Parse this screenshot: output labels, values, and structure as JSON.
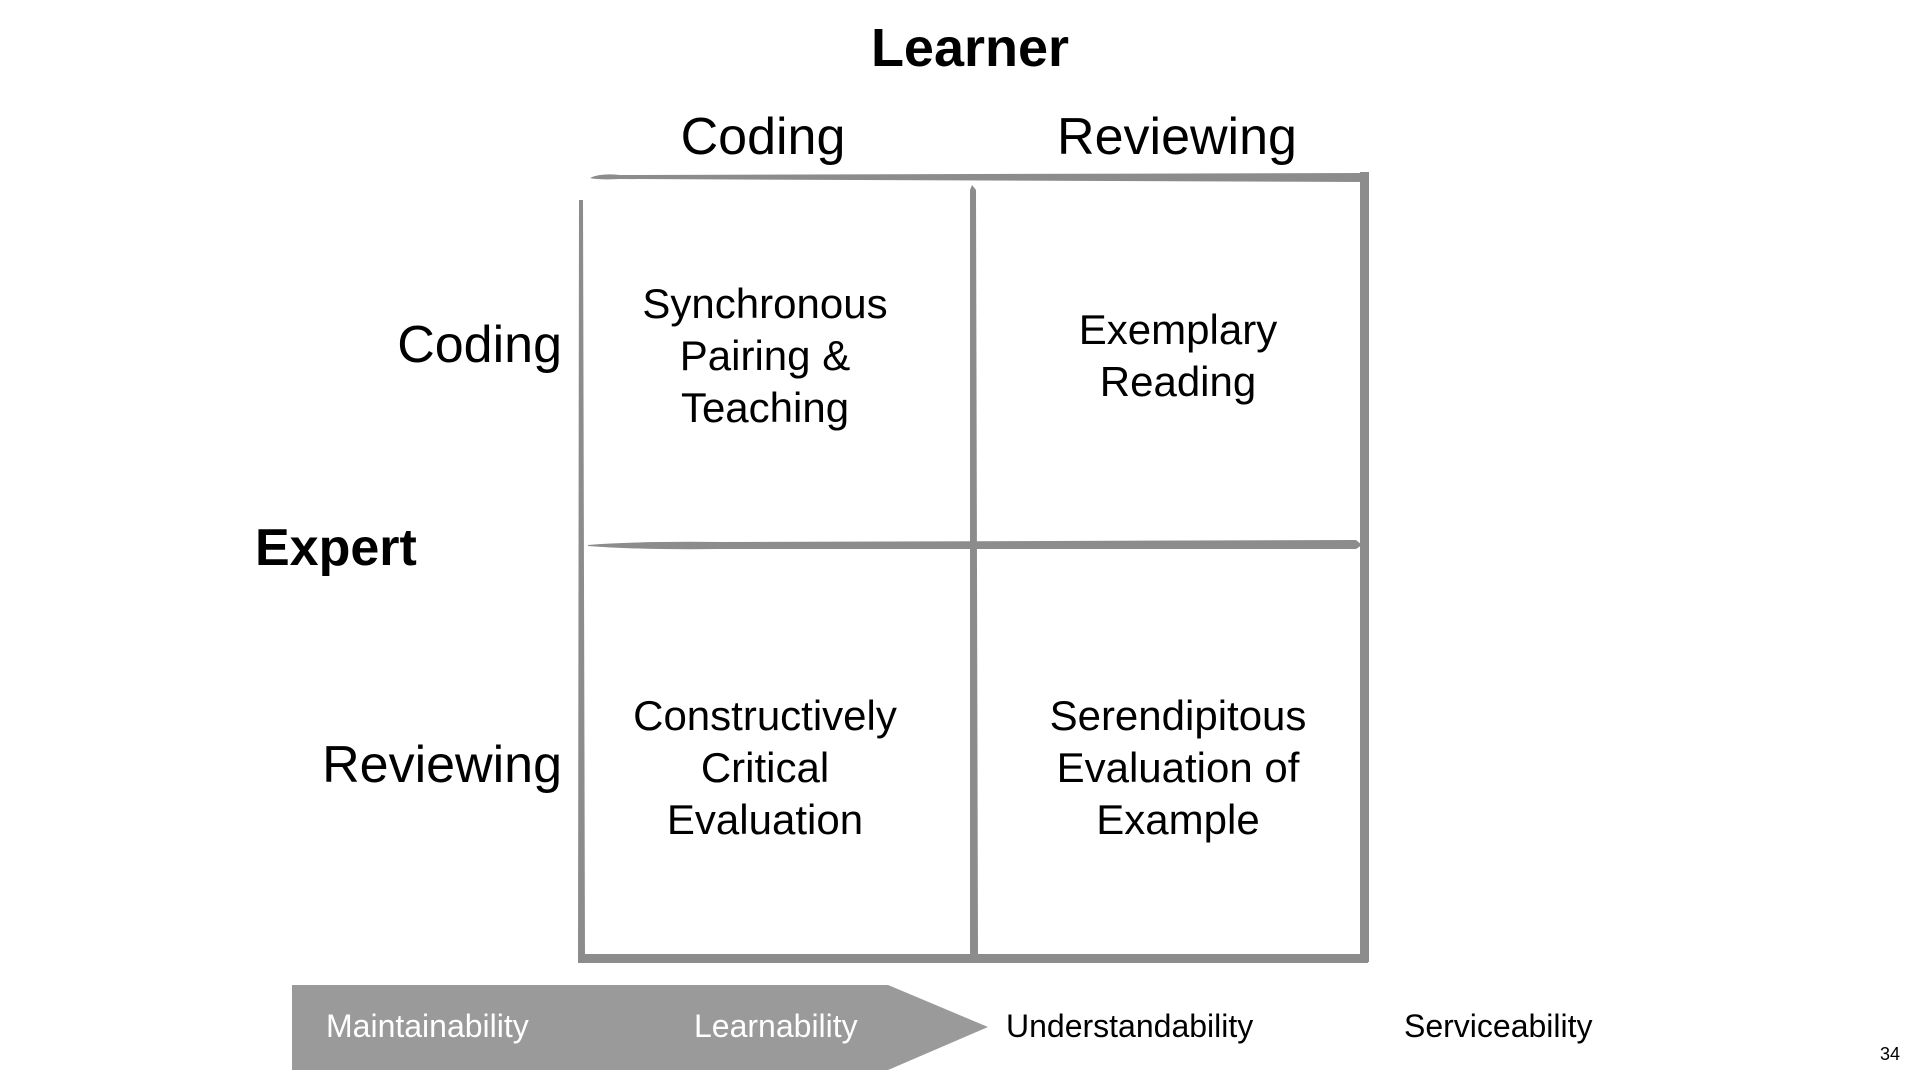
{
  "diagram": {
    "top_axis_title": "Learner",
    "side_axis_title": "Expert",
    "columns": [
      "Coding",
      "Reviewing"
    ],
    "rows": [
      "Coding",
      "Reviewing"
    ],
    "cells": {
      "coding_coding": "Synchronous\nPairing &\nTeaching",
      "coding_reviewing": "Exemplary\nReading",
      "reviewing_coding": "Constructively\nCritical\nEvaluation",
      "reviewing_reviewing": "Serendipitous\nEvaluation of\nExample"
    },
    "grid_color": "#8c8c8c"
  },
  "qualities_strip": {
    "items": [
      "Maintainability",
      "Learnability",
      "Understandability",
      "Serviceability"
    ],
    "highlighted_count": 2,
    "arrow_color": "#9a9a9a"
  },
  "slide": {
    "page_number": "34"
  }
}
